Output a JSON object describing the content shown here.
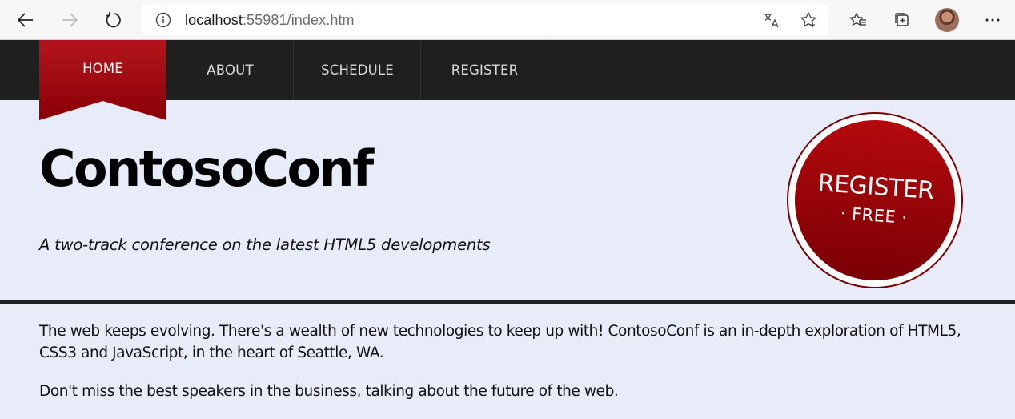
{
  "browser": {
    "url_host": "localhost",
    "url_rest": ":55981/index.htm",
    "icons": [
      "back-icon",
      "forward-icon",
      "refresh-icon",
      "info-icon",
      "translate-icon",
      "add-favorite-icon",
      "favorites-icon",
      "collections-icon",
      "profile-avatar",
      "more-icon"
    ]
  },
  "nav": {
    "items": [
      {
        "label": "HOME",
        "active": true
      },
      {
        "label": "ABOUT",
        "active": false
      },
      {
        "label": "SCHEDULE",
        "active": false
      },
      {
        "label": "REGISTER",
        "active": false
      }
    ],
    "active_color": "#a30a0f",
    "bar_color": "#1f1f1f"
  },
  "header": {
    "title": "ContosoConf",
    "tagline": "A two-track conference on the latest HTML5 developments",
    "badge": {
      "main": "REGISTER",
      "sub": "· FREE ·"
    },
    "background": "#e8ebf8"
  },
  "content": {
    "paragraphs": [
      "The web keeps evolving. There's a wealth of new technologies to keep up with! ContosoConf is an in-depth exploration of HTML5, CSS3 and JavaScript, in the heart of Seattle, WA.",
      "Don't miss the best speakers in the business, talking about the future of the web."
    ]
  }
}
